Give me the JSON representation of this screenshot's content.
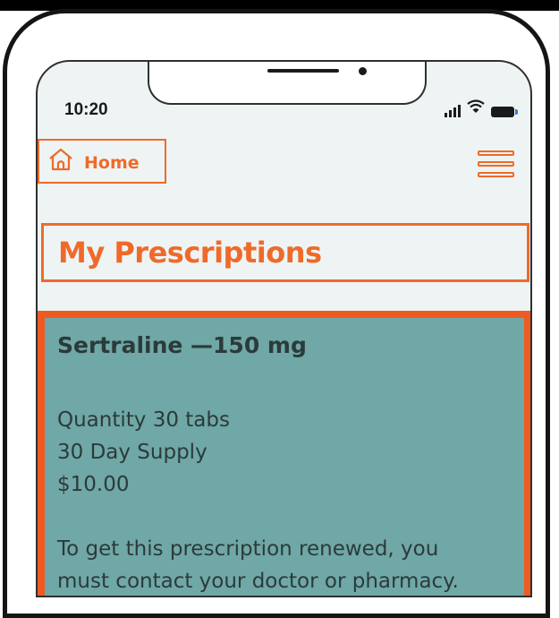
{
  "status_bar": {
    "time": "10:20",
    "icons": [
      "signal-icon",
      "wifi-icon",
      "battery-icon"
    ]
  },
  "nav": {
    "home_label": "Home",
    "home_icon": "home-icon",
    "menu_icon": "hamburger-menu-icon"
  },
  "page": {
    "title": "My Prescriptions"
  },
  "prescription": {
    "name": "Sertraline —150 mg",
    "quantity": "Quantity 30 tabs",
    "supply": "30 Day Supply",
    "price": "$10.00",
    "renewal_text": "To get this prescription renewed, you",
    "renewal_text_2": "must contact your doctor or pharmacy."
  },
  "colors": {
    "accent": "#ef6a2a",
    "card_border": "#ef5a23",
    "card_background": "#6fa8a6",
    "screen_background": "#eef4f3",
    "text_dark": "#2c3a3a"
  }
}
